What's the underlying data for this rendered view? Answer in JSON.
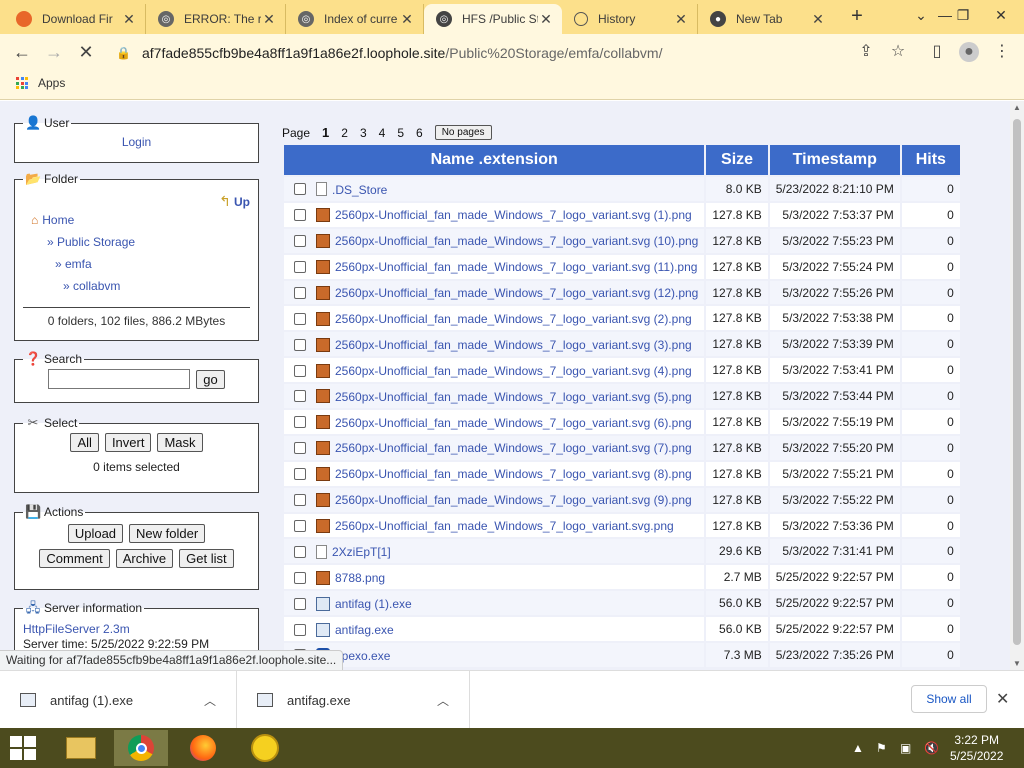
{
  "browser": {
    "tabs": [
      {
        "title": "Download Fir",
        "favicon": "firefox-icon",
        "color": "#e8672a"
      },
      {
        "title": "ERROR: The re",
        "favicon": "globe-icon",
        "color": "#666666"
      },
      {
        "title": "Index of curre",
        "favicon": "globe-icon",
        "color": "#666666"
      },
      {
        "title": "HFS /Public St",
        "favicon": "globe-icon",
        "color": "#444444",
        "active": true
      },
      {
        "title": "History",
        "favicon": "history-icon",
        "color": "#666666"
      },
      {
        "title": "New Tab",
        "favicon": "chrome-icon",
        "color": "#444444"
      }
    ],
    "url_host": "af7fade855cfb9be4a8ff1a9f1a86e2f.loophole.site",
    "url_path": "/Public%20Storage/emfa/collabvm/",
    "bookmarks_apps": "Apps",
    "accent": "#fce08b"
  },
  "sidebar": {
    "user_legend": "User",
    "login": "Login",
    "folder_legend": "Folder",
    "up": "Up",
    "home": "Home",
    "crumb1": "» Public Storage",
    "crumb2": "» emfa",
    "crumb3": "» collabvm",
    "folder_summary": "0 folders, 102 files, 886.2 MBytes",
    "search_legend": "Search",
    "search_go": "go",
    "select_legend": "Select",
    "select_all": "All",
    "select_invert": "Invert",
    "select_mask": "Mask",
    "items_selected": "0 items selected",
    "actions_legend": "Actions",
    "upload": "Upload",
    "new_folder": "New folder",
    "comment": "Comment",
    "archive": "Archive",
    "get_list": "Get list",
    "server_legend": "Server information",
    "server_name": "HttpFileServer 2.3m",
    "server_time": "Server time: 5/25/2022 9:22:59 PM"
  },
  "pager": {
    "label": "Page",
    "pages": [
      "1",
      "2",
      "3",
      "4",
      "5",
      "6"
    ],
    "no_pages": "No pages"
  },
  "table": {
    "headers": {
      "name": "Name .extension",
      "size": "Size",
      "timestamp": "Timestamp",
      "hits": "Hits"
    },
    "rows": [
      {
        "icon": "doc",
        "name": ".DS_Store",
        "size": "8.0 KB",
        "ts": "5/23/2022 8:21:10 PM",
        "hits": "0"
      },
      {
        "icon": "img",
        "name": "2560px-Unofficial_fan_made_Windows_7_logo_variant.svg (1).png",
        "size": "127.8 KB",
        "ts": "5/3/2022 7:53:37 PM",
        "hits": "0"
      },
      {
        "icon": "img",
        "name": "2560px-Unofficial_fan_made_Windows_7_logo_variant.svg (10).png",
        "size": "127.8 KB",
        "ts": "5/3/2022 7:55:23 PM",
        "hits": "0"
      },
      {
        "icon": "img",
        "name": "2560px-Unofficial_fan_made_Windows_7_logo_variant.svg (11).png",
        "size": "127.8 KB",
        "ts": "5/3/2022 7:55:24 PM",
        "hits": "0"
      },
      {
        "icon": "img",
        "name": "2560px-Unofficial_fan_made_Windows_7_logo_variant.svg (12).png",
        "size": "127.8 KB",
        "ts": "5/3/2022 7:55:26 PM",
        "hits": "0"
      },
      {
        "icon": "img",
        "name": "2560px-Unofficial_fan_made_Windows_7_logo_variant.svg (2).png",
        "size": "127.8 KB",
        "ts": "5/3/2022 7:53:38 PM",
        "hits": "0"
      },
      {
        "icon": "img",
        "name": "2560px-Unofficial_fan_made_Windows_7_logo_variant.svg (3).png",
        "size": "127.8 KB",
        "ts": "5/3/2022 7:53:39 PM",
        "hits": "0"
      },
      {
        "icon": "img",
        "name": "2560px-Unofficial_fan_made_Windows_7_logo_variant.svg (4).png",
        "size": "127.8 KB",
        "ts": "5/3/2022 7:53:41 PM",
        "hits": "0"
      },
      {
        "icon": "img",
        "name": "2560px-Unofficial_fan_made_Windows_7_logo_variant.svg (5).png",
        "size": "127.8 KB",
        "ts": "5/3/2022 7:53:44 PM",
        "hits": "0"
      },
      {
        "icon": "img",
        "name": "2560px-Unofficial_fan_made_Windows_7_logo_variant.svg (6).png",
        "size": "127.8 KB",
        "ts": "5/3/2022 7:55:19 PM",
        "hits": "0"
      },
      {
        "icon": "img",
        "name": "2560px-Unofficial_fan_made_Windows_7_logo_variant.svg (7).png",
        "size": "127.8 KB",
        "ts": "5/3/2022 7:55:20 PM",
        "hits": "0"
      },
      {
        "icon": "img",
        "name": "2560px-Unofficial_fan_made_Windows_7_logo_variant.svg (8).png",
        "size": "127.8 KB",
        "ts": "5/3/2022 7:55:21 PM",
        "hits": "0"
      },
      {
        "icon": "img",
        "name": "2560px-Unofficial_fan_made_Windows_7_logo_variant.svg (9).png",
        "size": "127.8 KB",
        "ts": "5/3/2022 7:55:22 PM",
        "hits": "0"
      },
      {
        "icon": "img",
        "name": "2560px-Unofficial_fan_made_Windows_7_logo_variant.svg.png",
        "size": "127.8 KB",
        "ts": "5/3/2022 7:53:36 PM",
        "hits": "0"
      },
      {
        "icon": "doc",
        "name": "2XziEpT[1]",
        "size": "29.6 KB",
        "ts": "5/3/2022 7:31:41 PM",
        "hits": "0"
      },
      {
        "icon": "img",
        "name": "8788.png",
        "size": "2.7 MB",
        "ts": "5/25/2022 9:22:57 PM",
        "hits": "0"
      },
      {
        "icon": "exe",
        "name": "antifag (1).exe",
        "size": "56.0 KB",
        "ts": "5/25/2022 9:22:57 PM",
        "hits": "0"
      },
      {
        "icon": "exe",
        "name": "antifag.exe",
        "size": "56.0 KB",
        "ts": "5/25/2022 9:22:57 PM",
        "hits": "0"
      },
      {
        "icon": "shield",
        "name": "apexo.exe",
        "size": "7.3 MB",
        "ts": "5/23/2022 7:35:26 PM",
        "hits": "0"
      }
    ]
  },
  "status_text": "Waiting for af7fade855cfb9be4a8ff1a9f1a86e2f.loophole.site...",
  "downloads": {
    "items": [
      "antifag (1).exe",
      "antifag.exe"
    ],
    "show_all": "Show all"
  },
  "taskbar": {
    "time": "3:22 PM",
    "date": "5/25/2022",
    "color": "#4c4b1e"
  }
}
